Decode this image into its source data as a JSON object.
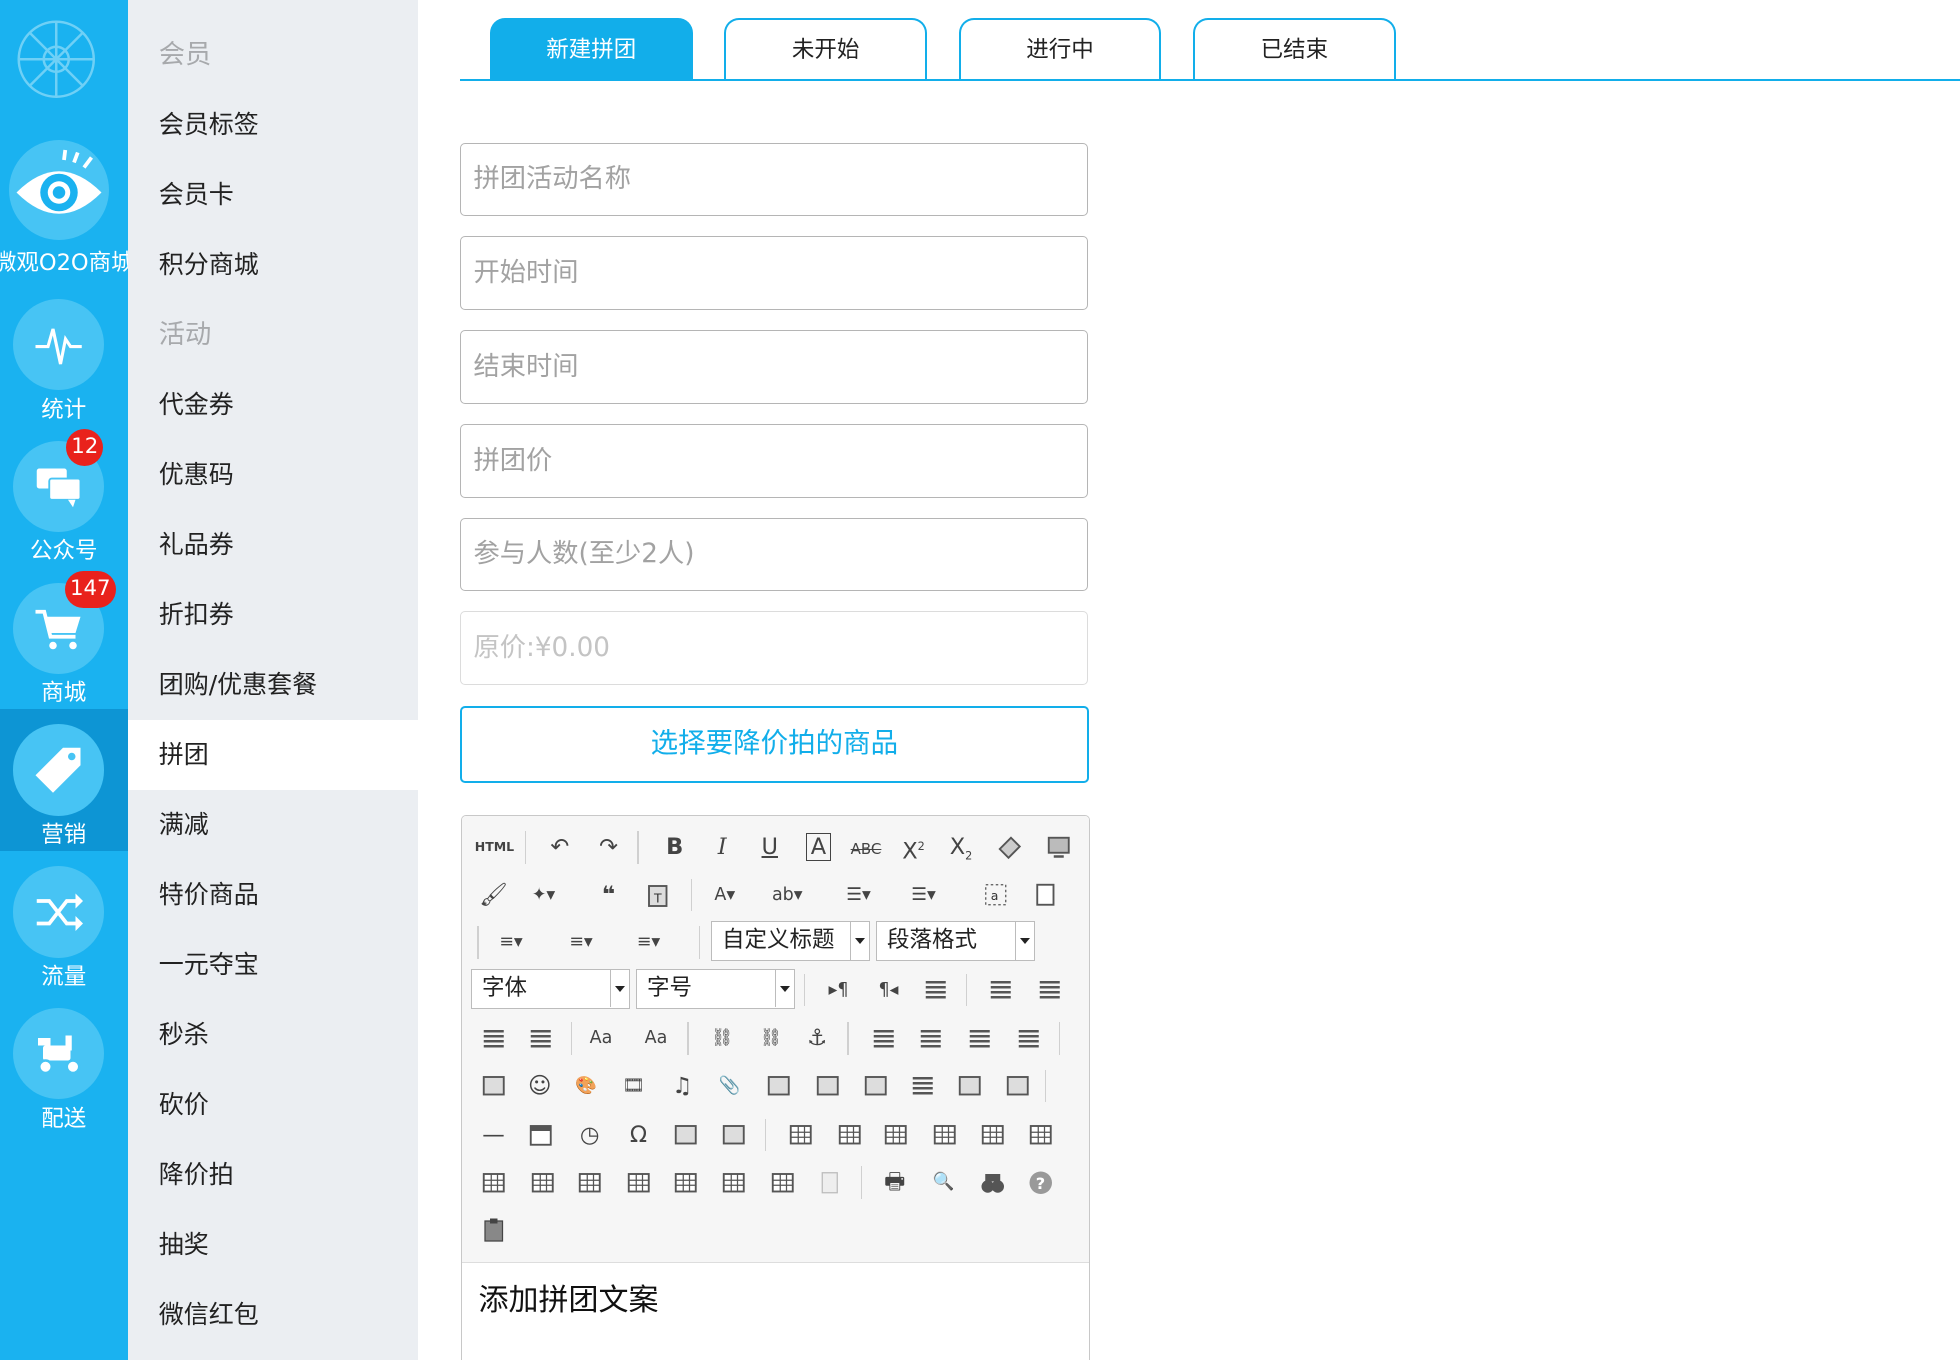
{
  "brand": {
    "name": "微观O2O商城"
  },
  "nav": [
    {
      "label": "统计",
      "icon": "pulse-icon"
    },
    {
      "label": "公众号",
      "icon": "chat-bubbles-icon",
      "badge": "12"
    },
    {
      "label": "商城",
      "icon": "shopping-cart-icon",
      "badge": "147"
    },
    {
      "label": "营销",
      "icon": "price-tag-icon",
      "active": true
    },
    {
      "label": "流量",
      "icon": "shuffle-icon"
    },
    {
      "label": "配送",
      "icon": "scooter-icon"
    }
  ],
  "submenu": {
    "sections": [
      {
        "header": "会员",
        "items": [
          "会员标签",
          "会员卡",
          "积分商城"
        ]
      },
      {
        "header": "活动",
        "items": [
          "代金券",
          "优惠码",
          "礼品券",
          "折扣券",
          "团购/优惠套餐",
          "拼团",
          "满减",
          "特价商品",
          "一元夺宝",
          "秒杀",
          "砍价",
          "降价拍",
          "抽奖",
          "微信红包"
        ]
      }
    ],
    "active_item": "拼团"
  },
  "tabs": [
    {
      "label": "新建拼团",
      "active": true
    },
    {
      "label": "未开始"
    },
    {
      "label": "进行中"
    },
    {
      "label": "已结束"
    }
  ],
  "form": {
    "name_placeholder": "拼团活动名称",
    "start_placeholder": "开始时间",
    "end_placeholder": "结束时间",
    "price_placeholder": "拼团价",
    "people_placeholder": "参与人数(至少2人)",
    "original_price_placeholder": "原价:¥0.00",
    "pick_button": "选择要降价拍的商品"
  },
  "editor": {
    "html_label": "HTML",
    "custom_heading": "自定义标题",
    "paragraph_format": "段落格式",
    "font_family": "字体",
    "font_size": "字号",
    "content": "添加拼团文案"
  },
  "colors": {
    "accent": "#12aeea",
    "sidebar": "#1ab2f0",
    "badge": "#e9221c"
  }
}
